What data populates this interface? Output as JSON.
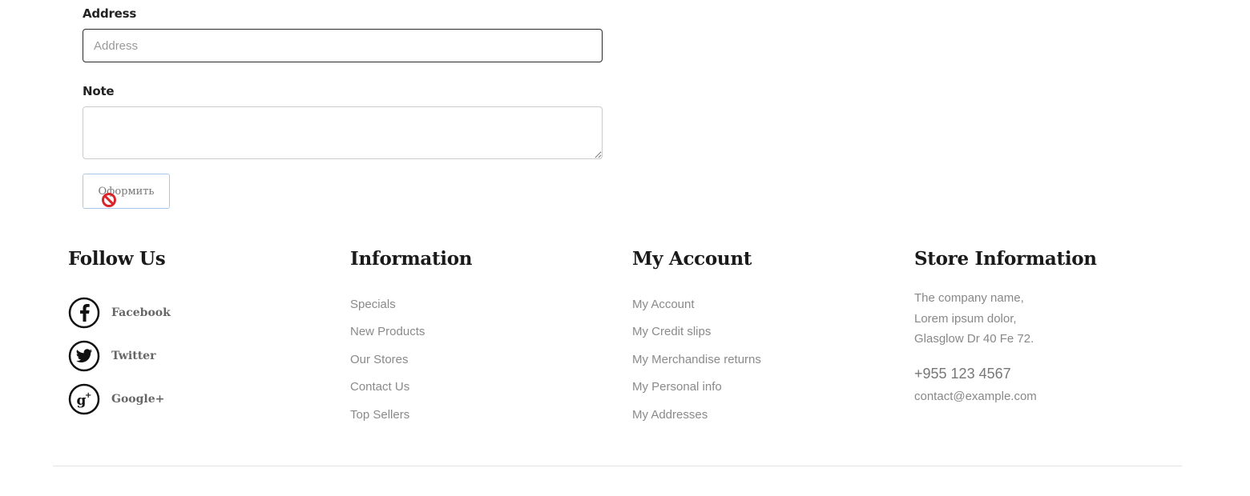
{
  "form": {
    "address_label": "Address",
    "address_placeholder": "Address",
    "address_value": "",
    "note_label": "Note",
    "note_value": "",
    "submit_label": "Оформить"
  },
  "footer": {
    "follow": {
      "title": "Follow Us",
      "items": [
        {
          "label": "Facebook",
          "icon": "facebook-icon"
        },
        {
          "label": "Twitter",
          "icon": "twitter-icon"
        },
        {
          "label": "Google+",
          "icon": "google-plus-icon"
        }
      ]
    },
    "information": {
      "title": "Information",
      "links": [
        "Specials",
        "New Products",
        "Our Stores",
        "Contact Us",
        "Top Sellers"
      ]
    },
    "account": {
      "title": "My Account",
      "links": [
        "My Account",
        "My Credit slips",
        "My Merchandise returns",
        "My Personal info",
        "My Addresses"
      ]
    },
    "store": {
      "title": "Store Information",
      "address_lines": [
        "The company name,",
        "Lorem ipsum dolor,",
        "Glasglow Dr 40 Fe 72."
      ],
      "phone": "+955 123 4567",
      "email": "contact@example.com"
    }
  },
  "cursor": {
    "icon": "not-allowed-cursor-icon",
    "color": "#d9262a"
  }
}
